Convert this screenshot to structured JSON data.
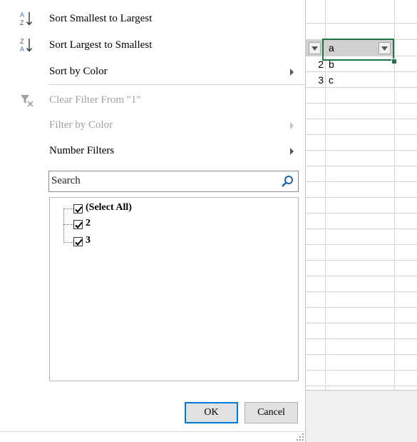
{
  "menu": {
    "sort_asc": "Sort Smallest to Largest",
    "sort_desc": "Sort Largest to Smallest",
    "sort_by_color": "Sort by Color",
    "clear_filter": "Clear Filter From \"1\"",
    "filter_by_color": "Filter by Color",
    "number_filters": "Number Filters"
  },
  "search": {
    "placeholder": "Search"
  },
  "filter_list": {
    "items": [
      {
        "label": "(Select All)",
        "checked": true
      },
      {
        "label": "2",
        "checked": true
      },
      {
        "label": "3",
        "checked": true
      }
    ]
  },
  "buttons": {
    "ok": "OK",
    "cancel": "Cancel"
  },
  "sheet": {
    "header_a": "a",
    "rows": [
      {
        "num": "2",
        "text": "b"
      },
      {
        "num": "3",
        "text": "c"
      }
    ]
  },
  "colors": {
    "accent": "#217346",
    "ok_border": "#0078d7",
    "disabled_text": "#a0a0a0"
  }
}
